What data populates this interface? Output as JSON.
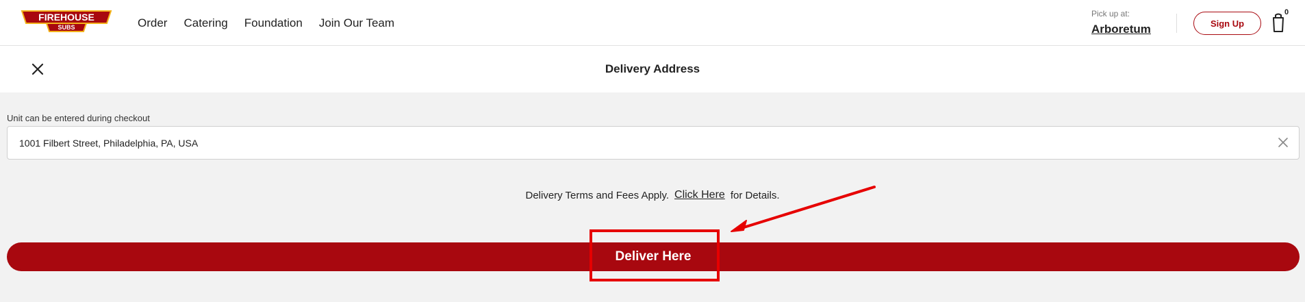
{
  "header": {
    "logo_top": "FIREHOUSE",
    "logo_bottom": "SUBS",
    "nav": [
      "Order",
      "Catering",
      "Foundation",
      "Join Our Team"
    ],
    "pickup_label": "Pick up at:",
    "pickup_store": "Arboretum",
    "signup_label": "Sign Up",
    "cart_count": "0"
  },
  "dialog": {
    "title": "Delivery Address",
    "hint": "Unit can be entered during checkout",
    "address_value": "1001 Filbert Street, Philadelphia, PA, USA",
    "terms_prefix": "Delivery Terms and Fees Apply.",
    "terms_link": "Click Here",
    "terms_suffix": "for Details.",
    "deliver_label": "Deliver Here"
  },
  "colors": {
    "brand_red": "#a8080f",
    "annotation_red": "#e60000"
  },
  "icons": {
    "close": "close-icon",
    "clear": "clear-input-icon",
    "cart": "cart-icon"
  }
}
